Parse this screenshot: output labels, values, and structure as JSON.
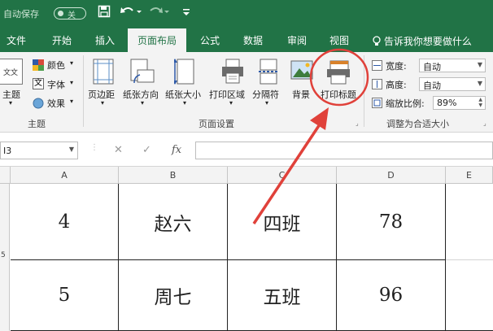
{
  "quick_access": {
    "autosave_label": "自动保存",
    "autosave_state": "关"
  },
  "tabs": [
    "文件",
    "开始",
    "插入",
    "页面布局",
    "公式",
    "数据",
    "审阅",
    "视图"
  ],
  "tell_me": "告诉我你想要做什么",
  "ribbon": {
    "themes": {
      "theme_button": "主题",
      "colors": "颜色",
      "fonts": "字体",
      "effects": "效果",
      "group_label": "主题"
    },
    "page_setup": {
      "margins": "页边距",
      "orientation": "纸张方向",
      "size": "纸张大小",
      "print_area": "打印区域",
      "breaks": "分隔符",
      "background": "背景",
      "print_titles": "打印标题",
      "group_label": "页面设置"
    },
    "scale_to_fit": {
      "width_label": "宽度:",
      "width_value": "自动",
      "height_label": "高度:",
      "height_value": "自动",
      "scale_label": "缩放比例:",
      "scale_value": "89%",
      "group_label": "调整为合适大小"
    }
  },
  "formula_bar": {
    "name_box": "I3",
    "fx": "fx",
    "cancel": "✕",
    "enter": "✓"
  },
  "columns": [
    "A",
    "B",
    "C",
    "D",
    "E"
  ],
  "rows": [
    {
      "row_number": "5",
      "cells": [
        "4",
        "赵六",
        "四班",
        "78",
        ""
      ]
    },
    {
      "row_number": "",
      "cells": [
        "5",
        "周七",
        "五班",
        "96",
        ""
      ]
    }
  ],
  "colors": {
    "brand": "#217346",
    "ribbon_bg": "#f3f3f3",
    "annotation": "#e0413a"
  }
}
